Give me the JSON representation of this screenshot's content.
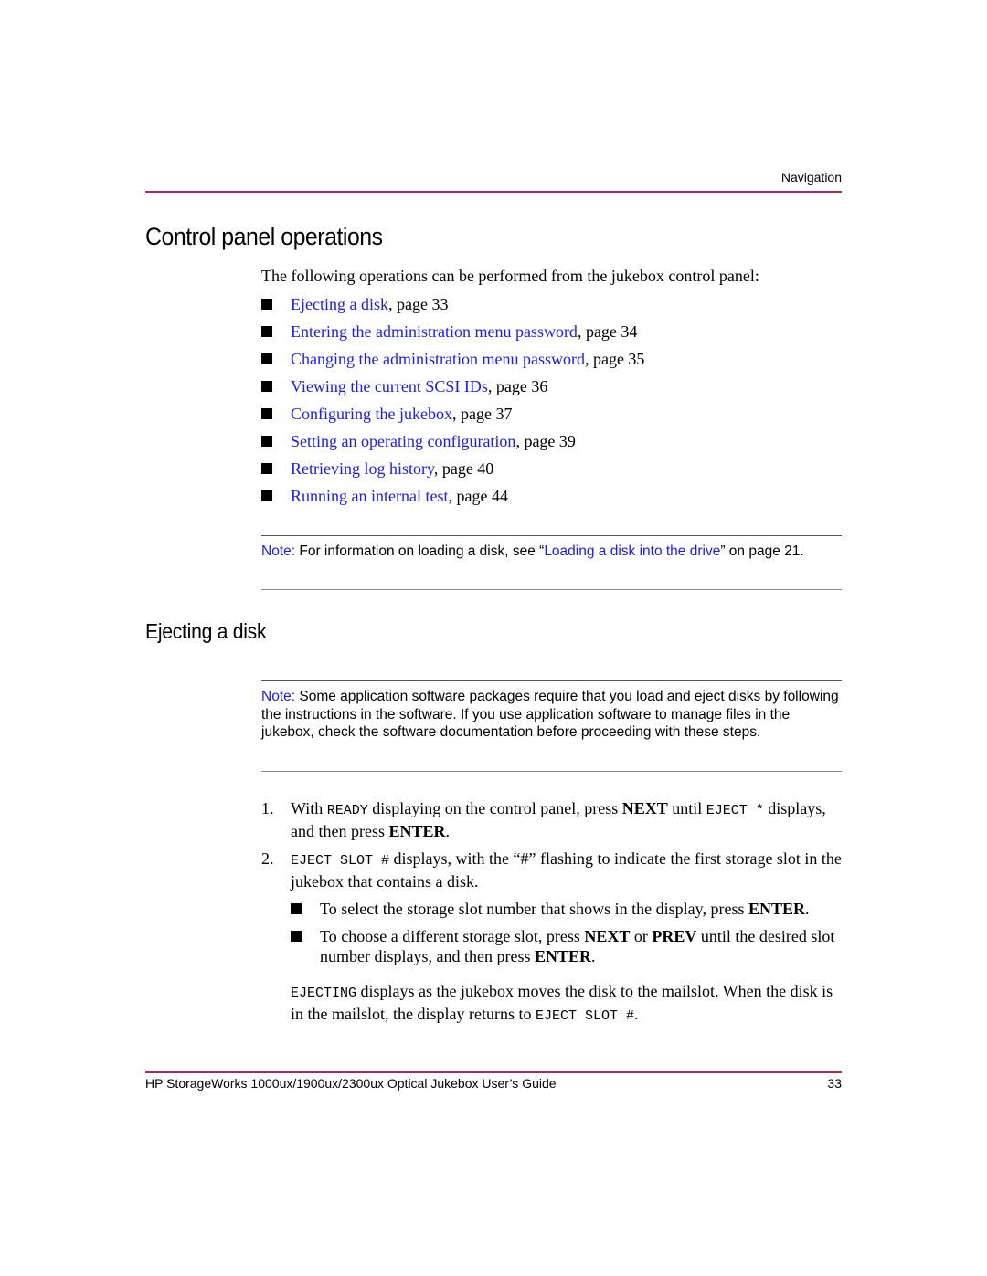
{
  "header": {
    "section_label": "Navigation"
  },
  "section": {
    "title": "Control panel operations",
    "intro": "The following operations can be performed from the jukebox control panel:",
    "operations": [
      {
        "link": "Ejecting a disk",
        "suffix": ", page 33"
      },
      {
        "link": "Entering the administration menu password",
        "suffix": ", page 34"
      },
      {
        "link": "Changing the administration menu password",
        "suffix": ", page 35"
      },
      {
        "link": "Viewing the current SCSI IDs",
        "suffix": ", page 36"
      },
      {
        "link": "Configuring the jukebox",
        "suffix": ", page 37"
      },
      {
        "link": "Setting an operating configuration",
        "suffix": ", page 39"
      },
      {
        "link": "Retrieving log history",
        "suffix": ", page 40"
      },
      {
        "link": "Running an internal test",
        "suffix": ", page 44"
      }
    ],
    "note": {
      "label": "Note:",
      "text_before": " For information on loading a disk, see “",
      "link": "Loading a disk into the drive",
      "text_after": "” on page 21."
    }
  },
  "subsection": {
    "title": "Ejecting a disk",
    "note": {
      "label": "Note:",
      "text": " Some application software packages require that you load and eject disks by following the instructions in the software. If you use application software to manage files in the jukebox, check the software documentation before proceeding with these steps."
    },
    "steps": [
      {
        "num": "1.",
        "parts": [
          {
            "t": "With "
          },
          {
            "m": "READY"
          },
          {
            "t": " displaying on the control panel, press "
          },
          {
            "b": "NEXT"
          },
          {
            "t": " until "
          },
          {
            "m": "EJECT *"
          },
          {
            "t": " displays, and then press "
          },
          {
            "b": "ENTER"
          },
          {
            "t": "."
          }
        ]
      },
      {
        "num": "2.",
        "parts": [
          {
            "m": "EJECT SLOT #"
          },
          {
            "t": " displays, with the “#” flashing to indicate the first storage slot in the jukebox that contains a disk."
          }
        ],
        "bullets": [
          [
            {
              "t": "To select the storage slot number that shows in the display, press "
            },
            {
              "b": "ENTER"
            },
            {
              "t": "."
            }
          ],
          [
            {
              "t": "To choose a different storage slot, press "
            },
            {
              "b": "NEXT"
            },
            {
              "t": " or "
            },
            {
              "b": "PREV"
            },
            {
              "t": " until the desired slot number displays, and then press "
            },
            {
              "b": "ENTER"
            },
            {
              "t": "."
            }
          ]
        ]
      }
    ],
    "result": [
      {
        "m": "EJECTING"
      },
      {
        "t": " displays as the jukebox moves the disk to the mailslot. When the disk is in the mailslot, the display returns to "
      },
      {
        "m": "EJECT SLOT #"
      },
      {
        "t": "."
      }
    ]
  },
  "footer": {
    "doc_title": "HP StorageWorks 1000ux/1900ux/2300ux Optical Jukebox User’s Guide",
    "page_number": "33"
  },
  "colors": {
    "rule": "#b0245f",
    "link": "#1a1aff"
  }
}
